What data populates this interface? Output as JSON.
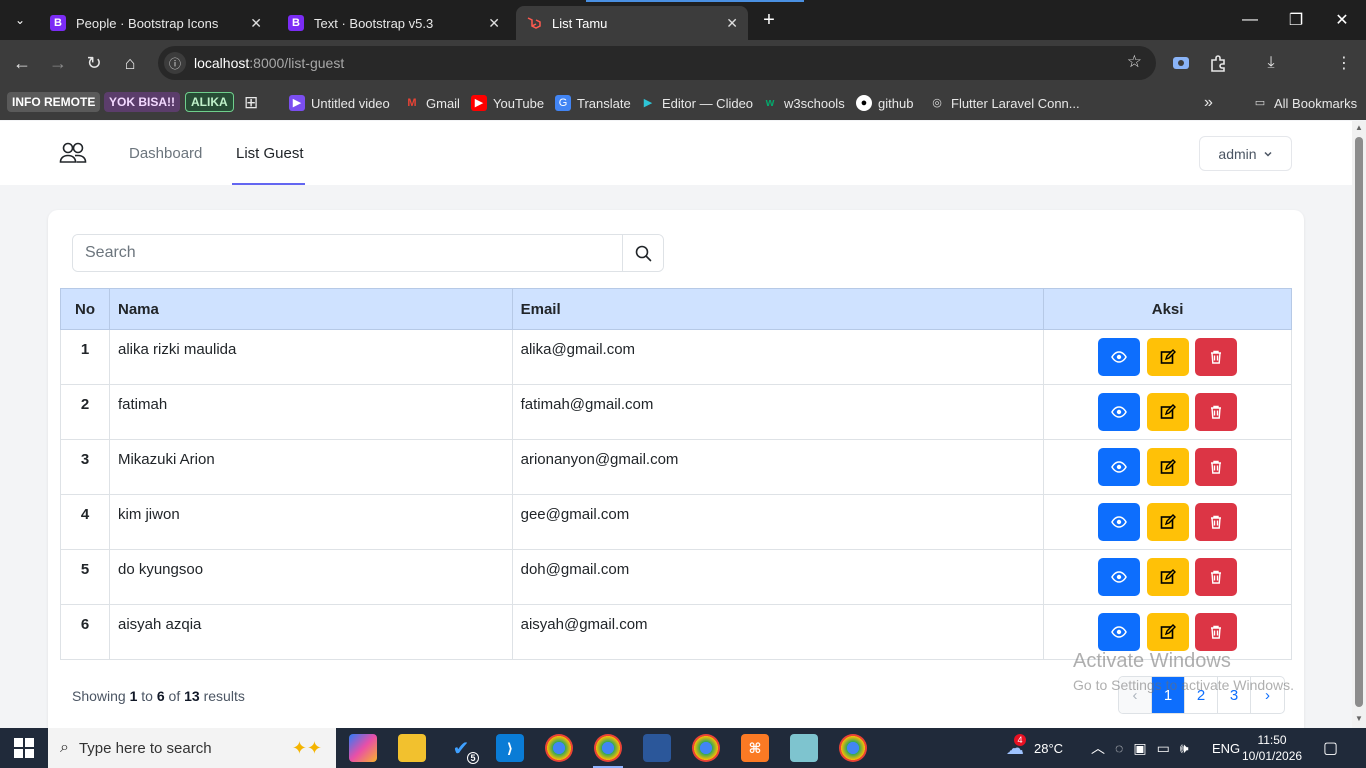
{
  "browser": {
    "tabs": [
      {
        "title": "People · Bootstrap Icons",
        "favicon": "B"
      },
      {
        "title": "Text · Bootstrap v5.3",
        "favicon": "B"
      },
      {
        "title": "List Tamu",
        "favicon": "laravel-icon"
      }
    ],
    "url_host": "localhost",
    "url_path": ":8000/list-guest",
    "bookmarks": {
      "badges": [
        "INFO REMOTE",
        "YOK BISA!!",
        "ALIKA"
      ],
      "items": [
        "Untitled video",
        "Gmail",
        "YouTube",
        "Translate",
        "Editor — Clideo",
        "w3schools",
        "github",
        "Flutter Laravel Conn..."
      ],
      "all_bookmarks": "All Bookmarks"
    }
  },
  "nav": {
    "links": [
      "Dashboard",
      "List Guest"
    ],
    "active": "List Guest",
    "user": "admin"
  },
  "search": {
    "placeholder": "Search",
    "value": ""
  },
  "table": {
    "headers": [
      "No",
      "Nama",
      "Email",
      "Aksi"
    ],
    "rows": [
      {
        "no": "1",
        "nama": "alika rizki maulida",
        "email": "alika@gmail.com"
      },
      {
        "no": "2",
        "nama": "fatimah",
        "email": "fatimah@gmail.com"
      },
      {
        "no": "3",
        "nama": "Mikazuki Arion",
        "email": "arionanyon@gmail.com"
      },
      {
        "no": "4",
        "nama": "kim jiwon",
        "email": "gee@gmail.com"
      },
      {
        "no": "5",
        "nama": "do kyungsoo",
        "email": "doh@gmail.com"
      },
      {
        "no": "6",
        "nama": "aisyah azqia",
        "email": "aisyah@gmail.com"
      }
    ]
  },
  "pagination": {
    "showing_prefix": "Showing",
    "from": "1",
    "to_word": "to",
    "to": "6",
    "of_word": "of",
    "total": "13",
    "results_word": "results",
    "prev": "‹",
    "pages": [
      "1",
      "2",
      "3"
    ],
    "next": "›",
    "current": "1"
  },
  "watermark": {
    "line1": "Activate Windows",
    "line2": "Go to Settings to activate Windows."
  },
  "taskbar": {
    "search_placeholder": "Type here to search",
    "weather": "28°C",
    "weather_badge": "4",
    "language": "ENG",
    "time": "11:50",
    "date": "10/01/2026",
    "app_badge": "5"
  },
  "colors": {
    "primary": "#0d6efd",
    "warning": "#ffc107",
    "danger": "#dc3545",
    "table_header": "#cfe2ff",
    "nav_accent": "#6366f1"
  }
}
